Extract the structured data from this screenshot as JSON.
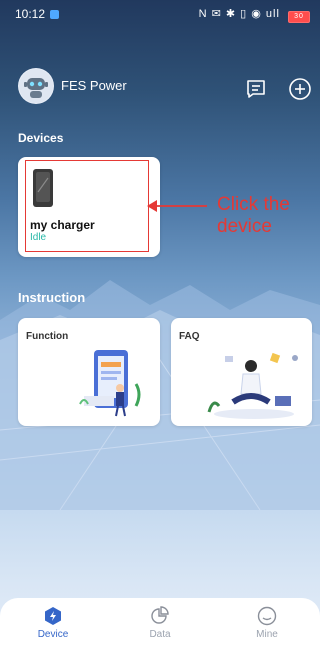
{
  "status_bar": {
    "time": "10:12",
    "right_icons": "N ✉ ✱ ▯ ◉ ull",
    "battery": "30"
  },
  "header": {
    "brand": "FES Power",
    "chat_icon": "message-icon",
    "add_icon": "plus-icon"
  },
  "devices": {
    "title": "Devices",
    "items": [
      {
        "name": "my charger",
        "status": "Idle"
      }
    ]
  },
  "annotation": {
    "text": "Click the device"
  },
  "instruction": {
    "title": "Instruction",
    "cards": [
      {
        "label": "Function"
      },
      {
        "label": "FAQ"
      }
    ]
  },
  "tabbar": {
    "tabs": [
      {
        "label": "Device",
        "icon": "device-icon",
        "active": true
      },
      {
        "label": "Data",
        "icon": "pie-chart-icon",
        "active": false
      },
      {
        "label": "Mine",
        "icon": "smiley-icon",
        "active": false
      }
    ]
  },
  "colors": {
    "accent": "#3566c8",
    "status_idle": "#28b8a8",
    "highlight": "#e53935"
  }
}
